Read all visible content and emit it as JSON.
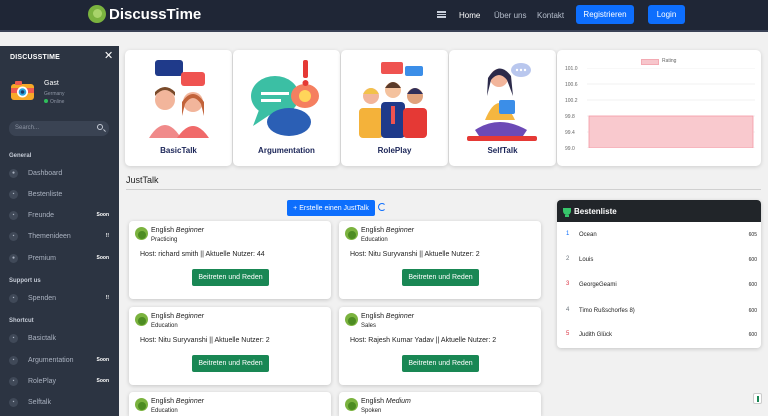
{
  "navbar": {
    "brand": "DiscussTime",
    "links": [
      {
        "label": "Home",
        "active": true
      },
      {
        "label": "Über uns",
        "active": false
      },
      {
        "label": "Kontakt",
        "active": false
      }
    ],
    "register_label": "Registrieren",
    "login_label": "Login"
  },
  "sidebar": {
    "title": "DISCUSSTIME",
    "close_icon": "✕",
    "user": {
      "name": "Gast",
      "country": "Germany",
      "status": "Online"
    },
    "search_placeholder": "Search...",
    "sections": [
      {
        "label": "General",
        "items": [
          {
            "label": "Dashboard",
            "badge": "",
            "icon": "dashboard-icon"
          },
          {
            "label": "Bestenliste",
            "badge": "",
            "icon": "leaderboard-icon"
          },
          {
            "label": "Freunde",
            "badge": "Soon",
            "icon": "friends-icon"
          },
          {
            "label": "Themenideen",
            "badge": "!!",
            "icon": "ideas-icon"
          },
          {
            "label": "Premium",
            "badge": "Soon",
            "icon": "premium-icon"
          }
        ]
      },
      {
        "label": "Support us",
        "items": [
          {
            "label": "Spenden",
            "badge": "!!",
            "icon": "donate-icon"
          }
        ]
      },
      {
        "label": "Shortcut",
        "items": [
          {
            "label": "Basictalk",
            "badge": "",
            "icon": "basictalk-icon"
          },
          {
            "label": "Argumentation",
            "badge": "Soon",
            "icon": "argumentation-icon"
          },
          {
            "label": "RolePlay",
            "badge": "Soon",
            "icon": "roleplay-icon"
          },
          {
            "label": "Selftalk",
            "badge": "",
            "icon": "selftalk-icon"
          }
        ]
      }
    ]
  },
  "categories": [
    {
      "title": "BasicTalk",
      "icon": "basictalk-illustration"
    },
    {
      "title": "Argumentation",
      "icon": "argumentation-illustration"
    },
    {
      "title": "RolePlay",
      "icon": "roleplay-illustration"
    },
    {
      "title": "SelfTalk",
      "icon": "selftalk-illustration"
    }
  ],
  "chart_data": {
    "type": "bar",
    "categories": [
      ""
    ],
    "series": [
      {
        "name": "Rating",
        "values": [
          99.8
        ]
      }
    ],
    "ylim": [
      99.0,
      101.0
    ],
    "yticks": [
      "101.0",
      "100.6",
      "100.2",
      "99.8",
      "99.4",
      "99.0"
    ],
    "legend": "top-center",
    "grid": true,
    "colors": {
      "fill": "#f9c9ce",
      "border": "#f49aa5"
    }
  },
  "justtalk": {
    "title": "JustTalk",
    "create_label": "+ Erstelle einen JustTalk",
    "join_label": "Beitreten und Reden",
    "talks": [
      {
        "language": "English",
        "level": "Beginner",
        "topic": "Practicing",
        "host": "Host: richard smith || Aktuelle Nutzer: 44"
      },
      {
        "language": "English",
        "level": "Beginner",
        "topic": "Education",
        "host": "Host: Nitu Suryvanshi || Aktuelle Nutzer: 2"
      },
      {
        "language": "English",
        "level": "Beginner",
        "topic": "Education",
        "host": "Host: Nitu Suryvanshi || Aktuelle Nutzer: 2"
      },
      {
        "language": "English",
        "level": "Beginner",
        "topic": "Sales",
        "host": "Host: Rajesh Kumar Yadav || Aktuelle Nutzer: 2"
      },
      {
        "language": "English",
        "level": "Beginner",
        "topic": "Education",
        "host": ""
      },
      {
        "language": "English",
        "level": "Medium",
        "topic": "Spoken",
        "host": ""
      }
    ]
  },
  "leaderboard": {
    "title": "Bestenliste",
    "rows": [
      {
        "rank": "1",
        "name": "Ocean",
        "score": "605",
        "color": "#0d6efd"
      },
      {
        "rank": "2",
        "name": "Louis",
        "score": "600",
        "color": "#6c757d"
      },
      {
        "rank": "3",
        "name": "GeorgeGeami",
        "score": "600",
        "color": "#dc3545"
      },
      {
        "rank": "4",
        "name": "Timo Rußschorfes 8)",
        "score": "600",
        "color": "#6c757d"
      },
      {
        "rank": "5",
        "name": "Judith Glück",
        "score": "600",
        "color": "#dc3545"
      }
    ]
  }
}
